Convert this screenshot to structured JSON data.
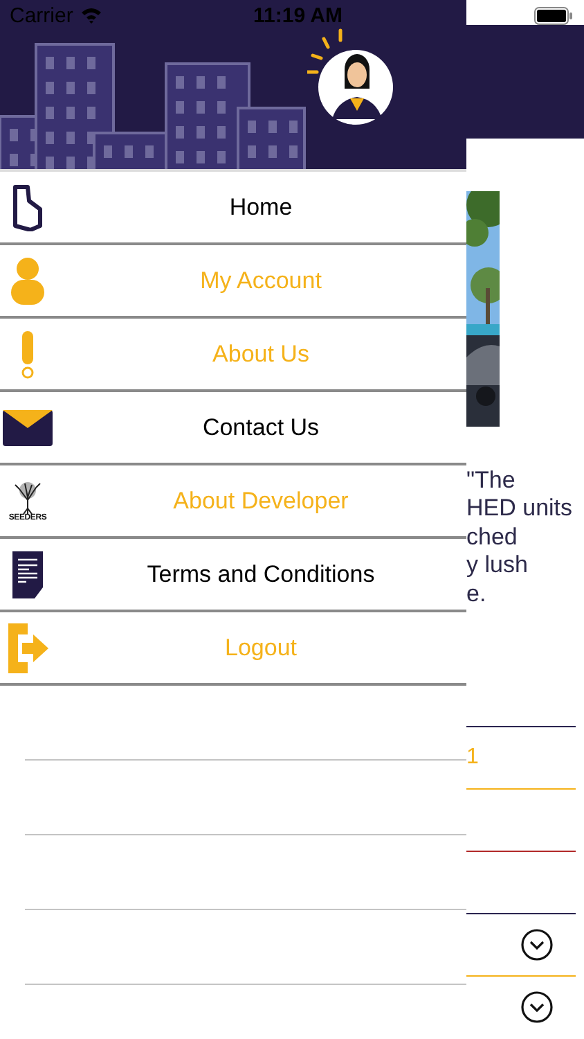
{
  "status_bar": {
    "carrier": "Carrier",
    "time": "11:19 AM"
  },
  "menu": {
    "items": [
      {
        "label": "Home",
        "kind": "home",
        "color": "#000000"
      },
      {
        "label": "My Account",
        "kind": "account",
        "color": "#f5b21a"
      },
      {
        "label": "About Us",
        "kind": "about",
        "color": "#f5b21a"
      },
      {
        "label": "Contact Us",
        "kind": "contact",
        "color": "#000000"
      },
      {
        "label": "About Developer",
        "kind": "developer",
        "icon_text": "SEEDERS",
        "color": "#f5b21a"
      },
      {
        "label": "Terms and Conditions",
        "kind": "terms",
        "color": "#000000"
      },
      {
        "label": "Logout",
        "kind": "logout",
        "color": "#f5b21a"
      }
    ]
  },
  "background": {
    "text_lines": [
      "\"The",
      "HED units",
      "ched",
      "y lush",
      "e."
    ],
    "fields": [
      {
        "color": "#2b2550"
      },
      {
        "value": "1",
        "color": "#f5b21a"
      },
      {
        "color": "#b22a2a"
      },
      {
        "color": "#2b2550"
      },
      {
        "dropdown": true,
        "color": "#f5b21a"
      },
      {
        "dropdown": true
      }
    ]
  }
}
